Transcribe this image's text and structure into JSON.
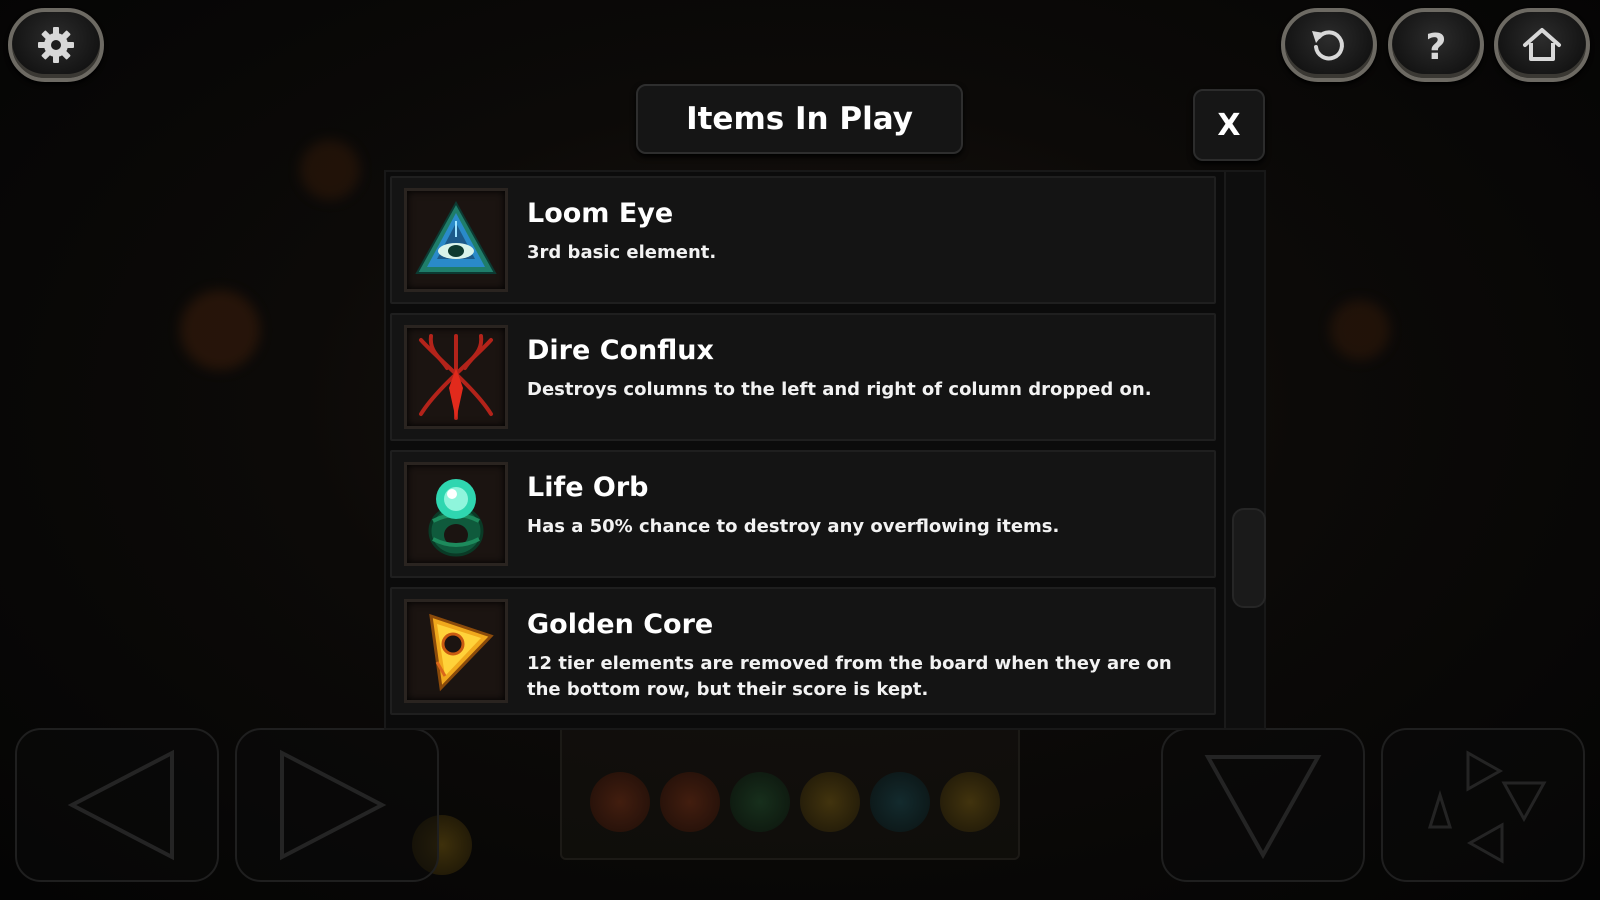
{
  "dialog": {
    "title": "Items In Play",
    "close_label": "X"
  },
  "header_buttons": [
    {
      "name": "settings",
      "icon": "gear-icon"
    },
    {
      "name": "restart",
      "icon": "restart-icon"
    },
    {
      "name": "help",
      "icon": "help-icon"
    },
    {
      "name": "home",
      "icon": "home-icon"
    }
  ],
  "items": [
    {
      "name": "Loom Eye",
      "description": "3rd basic element.",
      "icon": "loom-eye-icon"
    },
    {
      "name": "Dire Conflux",
      "description": "Destroys columns to the left and right of column dropped on.",
      "icon": "dire-conflux-icon"
    },
    {
      "name": "Life Orb",
      "description": "Has a 50% chance to destroy any overflowing items.",
      "icon": "life-orb-icon"
    },
    {
      "name": "Golden Core",
      "description": "12 tier elements are removed from the board when they are on the bottom row, but their score is kept.",
      "icon": "golden-core-icon"
    }
  ],
  "controls": [
    {
      "name": "move-left",
      "icon": "left-arrow-icon"
    },
    {
      "name": "move-right",
      "icon": "right-arrow-icon"
    },
    {
      "name": "drop",
      "icon": "down-arrow-icon"
    },
    {
      "name": "rotate",
      "icon": "rotate-triangles-icon"
    }
  ],
  "colors": {
    "panel_bg": "#141414",
    "text": "#ffffff",
    "button_rim": "#6d6a63"
  }
}
